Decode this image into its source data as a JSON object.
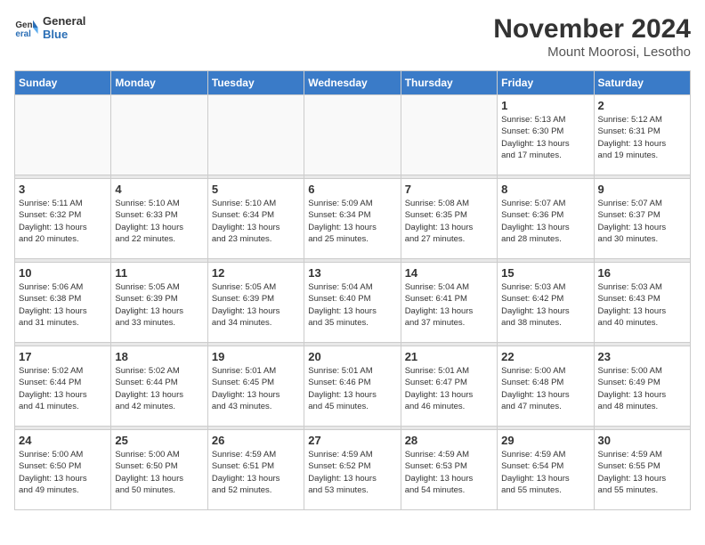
{
  "header": {
    "logo": {
      "general": "General",
      "blue": "Blue"
    },
    "title": "November 2024",
    "location": "Mount Moorosi, Lesotho"
  },
  "weekdays": [
    "Sunday",
    "Monday",
    "Tuesday",
    "Wednesday",
    "Thursday",
    "Friday",
    "Saturday"
  ],
  "weeks": [
    {
      "days": [
        {
          "num": "",
          "info": ""
        },
        {
          "num": "",
          "info": ""
        },
        {
          "num": "",
          "info": ""
        },
        {
          "num": "",
          "info": ""
        },
        {
          "num": "",
          "info": ""
        },
        {
          "num": "1",
          "info": "Sunrise: 5:13 AM\nSunset: 6:30 PM\nDaylight: 13 hours\nand 17 minutes."
        },
        {
          "num": "2",
          "info": "Sunrise: 5:12 AM\nSunset: 6:31 PM\nDaylight: 13 hours\nand 19 minutes."
        }
      ]
    },
    {
      "days": [
        {
          "num": "3",
          "info": "Sunrise: 5:11 AM\nSunset: 6:32 PM\nDaylight: 13 hours\nand 20 minutes."
        },
        {
          "num": "4",
          "info": "Sunrise: 5:10 AM\nSunset: 6:33 PM\nDaylight: 13 hours\nand 22 minutes."
        },
        {
          "num": "5",
          "info": "Sunrise: 5:10 AM\nSunset: 6:34 PM\nDaylight: 13 hours\nand 23 minutes."
        },
        {
          "num": "6",
          "info": "Sunrise: 5:09 AM\nSunset: 6:34 PM\nDaylight: 13 hours\nand 25 minutes."
        },
        {
          "num": "7",
          "info": "Sunrise: 5:08 AM\nSunset: 6:35 PM\nDaylight: 13 hours\nand 27 minutes."
        },
        {
          "num": "8",
          "info": "Sunrise: 5:07 AM\nSunset: 6:36 PM\nDaylight: 13 hours\nand 28 minutes."
        },
        {
          "num": "9",
          "info": "Sunrise: 5:07 AM\nSunset: 6:37 PM\nDaylight: 13 hours\nand 30 minutes."
        }
      ]
    },
    {
      "days": [
        {
          "num": "10",
          "info": "Sunrise: 5:06 AM\nSunset: 6:38 PM\nDaylight: 13 hours\nand 31 minutes."
        },
        {
          "num": "11",
          "info": "Sunrise: 5:05 AM\nSunset: 6:39 PM\nDaylight: 13 hours\nand 33 minutes."
        },
        {
          "num": "12",
          "info": "Sunrise: 5:05 AM\nSunset: 6:39 PM\nDaylight: 13 hours\nand 34 minutes."
        },
        {
          "num": "13",
          "info": "Sunrise: 5:04 AM\nSunset: 6:40 PM\nDaylight: 13 hours\nand 35 minutes."
        },
        {
          "num": "14",
          "info": "Sunrise: 5:04 AM\nSunset: 6:41 PM\nDaylight: 13 hours\nand 37 minutes."
        },
        {
          "num": "15",
          "info": "Sunrise: 5:03 AM\nSunset: 6:42 PM\nDaylight: 13 hours\nand 38 minutes."
        },
        {
          "num": "16",
          "info": "Sunrise: 5:03 AM\nSunset: 6:43 PM\nDaylight: 13 hours\nand 40 minutes."
        }
      ]
    },
    {
      "days": [
        {
          "num": "17",
          "info": "Sunrise: 5:02 AM\nSunset: 6:44 PM\nDaylight: 13 hours\nand 41 minutes."
        },
        {
          "num": "18",
          "info": "Sunrise: 5:02 AM\nSunset: 6:44 PM\nDaylight: 13 hours\nand 42 minutes."
        },
        {
          "num": "19",
          "info": "Sunrise: 5:01 AM\nSunset: 6:45 PM\nDaylight: 13 hours\nand 43 minutes."
        },
        {
          "num": "20",
          "info": "Sunrise: 5:01 AM\nSunset: 6:46 PM\nDaylight: 13 hours\nand 45 minutes."
        },
        {
          "num": "21",
          "info": "Sunrise: 5:01 AM\nSunset: 6:47 PM\nDaylight: 13 hours\nand 46 minutes."
        },
        {
          "num": "22",
          "info": "Sunrise: 5:00 AM\nSunset: 6:48 PM\nDaylight: 13 hours\nand 47 minutes."
        },
        {
          "num": "23",
          "info": "Sunrise: 5:00 AM\nSunset: 6:49 PM\nDaylight: 13 hours\nand 48 minutes."
        }
      ]
    },
    {
      "days": [
        {
          "num": "24",
          "info": "Sunrise: 5:00 AM\nSunset: 6:50 PM\nDaylight: 13 hours\nand 49 minutes."
        },
        {
          "num": "25",
          "info": "Sunrise: 5:00 AM\nSunset: 6:50 PM\nDaylight: 13 hours\nand 50 minutes."
        },
        {
          "num": "26",
          "info": "Sunrise: 4:59 AM\nSunset: 6:51 PM\nDaylight: 13 hours\nand 52 minutes."
        },
        {
          "num": "27",
          "info": "Sunrise: 4:59 AM\nSunset: 6:52 PM\nDaylight: 13 hours\nand 53 minutes."
        },
        {
          "num": "28",
          "info": "Sunrise: 4:59 AM\nSunset: 6:53 PM\nDaylight: 13 hours\nand 54 minutes."
        },
        {
          "num": "29",
          "info": "Sunrise: 4:59 AM\nSunset: 6:54 PM\nDaylight: 13 hours\nand 55 minutes."
        },
        {
          "num": "30",
          "info": "Sunrise: 4:59 AM\nSunset: 6:55 PM\nDaylight: 13 hours\nand 55 minutes."
        }
      ]
    }
  ]
}
